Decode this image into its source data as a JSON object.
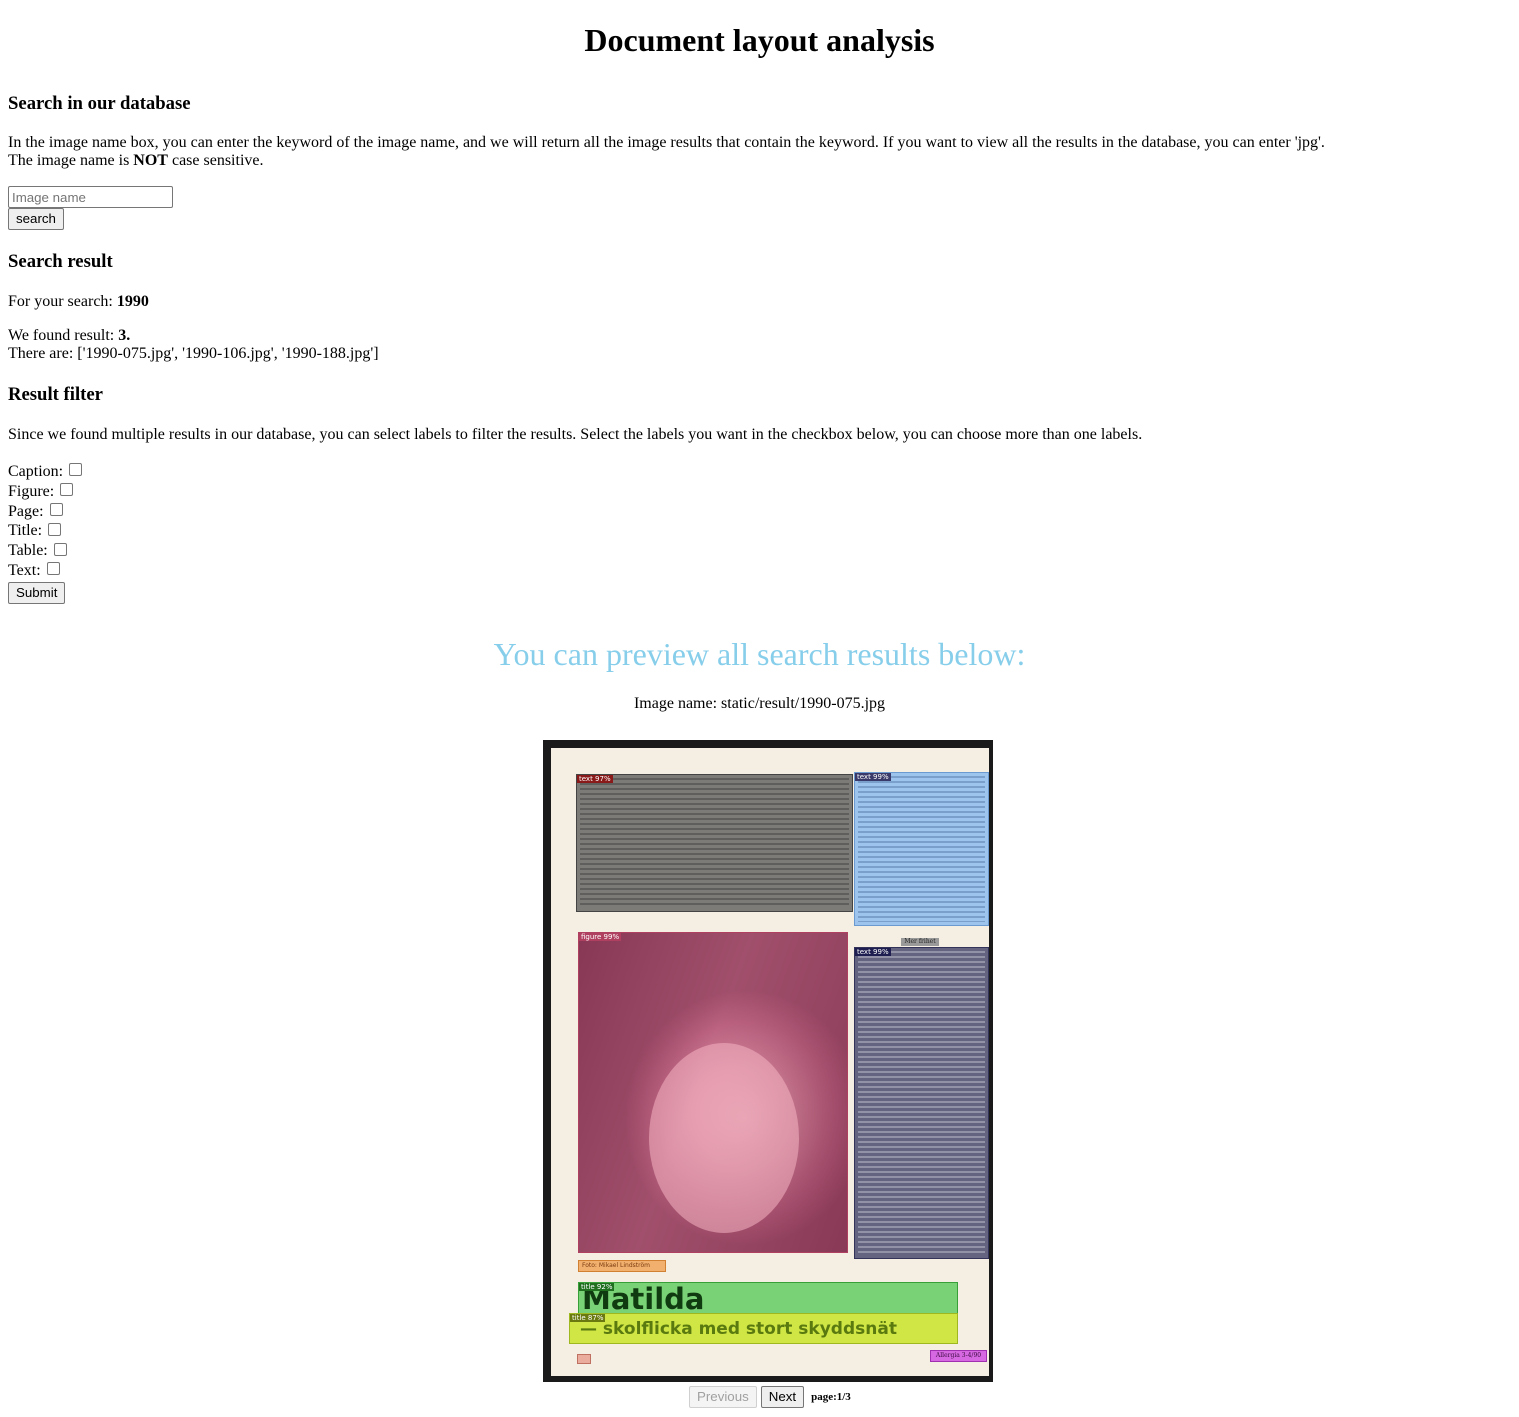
{
  "page_title": "Document layout analysis",
  "search_section": {
    "heading": "Search in our database",
    "intro_line1": "In the image name box, you can enter the keyword of the image name, and we will return all the image results that contain the keyword. If you want to view all the results in the database, you can enter 'jpg'.",
    "intro_line2_prefix": "The image name is ",
    "intro_line2_bold": "NOT",
    "intro_line2_suffix": " case sensitive.",
    "input_placeholder": "Image name",
    "input_value": "",
    "button_label": "search"
  },
  "result_section": {
    "heading": "Search result",
    "query_prefix": "For your search: ",
    "query_value": "1990",
    "found_prefix": "We found result: ",
    "found_value": "3.",
    "list_prefix": "There are: ",
    "list_value": "['1990-075.jpg', '1990-106.jpg', '1990-188.jpg']"
  },
  "filter_section": {
    "heading": "Result filter",
    "description": "Since we found multiple results in our database, you can select labels to filter the results. Select the labels you want in the checkbox below, you can choose more than one labels.",
    "labels": [
      "Caption:",
      "Figure:",
      "Page:",
      "Title:",
      "Table:",
      "Text:"
    ],
    "submit_label": "Submit"
  },
  "preview": {
    "heading": "You can preview all search results below:",
    "image_name_prefix": "Image name: ",
    "image_name": "static/result/1990-075.jpg",
    "detections": [
      {
        "label": "text 97%",
        "color": "#6b6b6b"
      },
      {
        "label": "text 99%",
        "color": "#7fb6f0"
      },
      {
        "label": "figure 99%",
        "color": "#d9607f"
      },
      {
        "label": "text 99%",
        "color": "#4a4a72"
      },
      {
        "label": "caption",
        "color": "#f0a050"
      },
      {
        "label": "title 92%",
        "color": "#50c850"
      },
      {
        "label": "title 87%",
        "color": "#c8e030"
      },
      {
        "label": "page",
        "color": "#e8a090"
      },
      {
        "label": "page",
        "color": "#d050e0"
      }
    ],
    "page_text": {
      "title": "Matilda",
      "subtitle": "— skolflicka med stort skyddsnät",
      "photo_credit": "Foto: Mikael Lindström",
      "footer": "Allergia 3-4/90",
      "subheading": "Mer frihet"
    },
    "pager": {
      "previous_label": "Previous",
      "next_label": "Next",
      "page_info": "page:1/3"
    }
  }
}
